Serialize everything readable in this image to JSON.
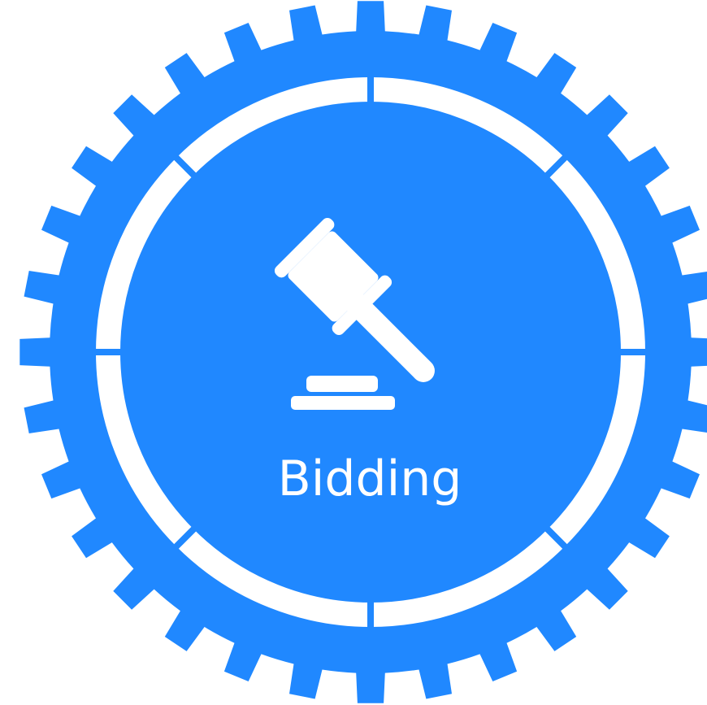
{
  "badge": {
    "label": "Bidding",
    "icon": "gavel-icon",
    "shape": "gear",
    "colors": {
      "primary": "#2088FF",
      "foreground": "#FFFFFF",
      "background": "#FFFFFF"
    }
  }
}
